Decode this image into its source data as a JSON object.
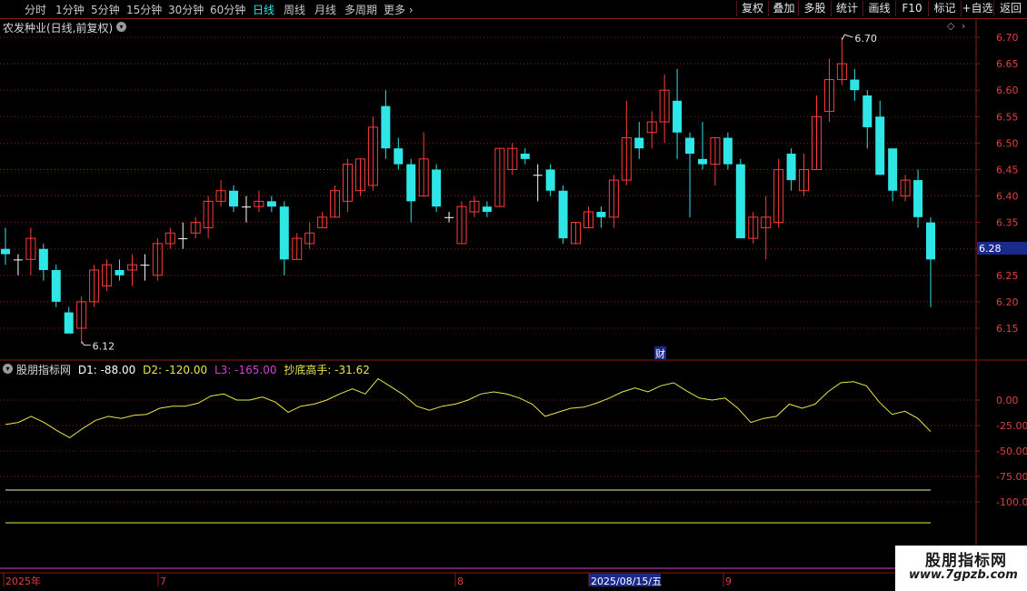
{
  "toolbar": {
    "timeframes": [
      "分时",
      "1分钟",
      "5分钟",
      "15分钟",
      "30分钟",
      "60分钟",
      "日线",
      "周线",
      "月线",
      "多周期",
      "更多"
    ],
    "active_timeframe": "日线",
    "right_buttons": [
      "复权",
      "叠加",
      "多股",
      "统计",
      "画线",
      "F10",
      "标记",
      "+自选",
      "返回"
    ]
  },
  "chart_title": "农发种业(日线,前复权)",
  "indicator": {
    "name": "股朋指标网",
    "d1_label": "D1: -88.00",
    "d2_label": "D2: -120.00",
    "l3_label": "L3: -165.00",
    "cd_label": "抄底高手: -31.62"
  },
  "annotations": {
    "high": "6.70",
    "low": "6.12",
    "fin_marker": "财",
    "current_price": "6.28"
  },
  "date_axis": {
    "labels": [
      "2025年",
      "7",
      "8",
      "2025/08/15/五",
      "9"
    ]
  },
  "watermark": {
    "line1": "股朋指标网",
    "line2": "www.7gpzb.com"
  },
  "colors": {
    "up": "#ff3b3b",
    "down": "#2ee6e6",
    "flat": "#ffffff",
    "indicator_line": "#e8e84a",
    "d1_line": "#ffffff",
    "d2_line": "#e8e84a",
    "l3": "#cc44cc",
    "grid": "#8b1a1a"
  },
  "chart_data": [
    {
      "type": "candlestick",
      "ylim": [
        6.1,
        6.72
      ],
      "yticks": [
        "6.70",
        "6.65",
        "6.60",
        "6.55",
        "6.50",
        "6.45",
        "6.40",
        "6.35",
        "6.30",
        "6.25",
        "6.20",
        "6.15"
      ],
      "candles": [
        {
          "o": 6.3,
          "h": 6.34,
          "l": 6.27,
          "c": 6.29
        },
        {
          "o": 6.28,
          "h": 6.29,
          "l": 6.25,
          "c": 6.28
        },
        {
          "o": 6.28,
          "h": 6.34,
          "l": 6.25,
          "c": 6.32
        },
        {
          "o": 6.3,
          "h": 6.31,
          "l": 6.24,
          "c": 6.26
        },
        {
          "o": 6.26,
          "h": 6.27,
          "l": 6.19,
          "c": 6.2
        },
        {
          "o": 6.18,
          "h": 6.19,
          "l": 6.14,
          "c": 6.14
        },
        {
          "o": 6.15,
          "h": 6.21,
          "l": 6.12,
          "c": 6.2
        },
        {
          "o": 6.2,
          "h": 6.27,
          "l": 6.19,
          "c": 6.26
        },
        {
          "o": 6.23,
          "h": 6.28,
          "l": 6.22,
          "c": 6.27
        },
        {
          "o": 6.26,
          "h": 6.28,
          "l": 6.24,
          "c": 6.25
        },
        {
          "o": 6.26,
          "h": 6.29,
          "l": 6.23,
          "c": 6.27
        },
        {
          "o": 6.27,
          "h": 6.29,
          "l": 6.24,
          "c": 6.27
        },
        {
          "o": 6.25,
          "h": 6.32,
          "l": 6.24,
          "c": 6.31
        },
        {
          "o": 6.31,
          "h": 6.34,
          "l": 6.3,
          "c": 6.33
        },
        {
          "o": 6.32,
          "h": 6.35,
          "l": 6.3,
          "c": 6.32
        },
        {
          "o": 6.33,
          "h": 6.36,
          "l": 6.32,
          "c": 6.35
        },
        {
          "o": 6.34,
          "h": 6.4,
          "l": 6.32,
          "c": 6.39
        },
        {
          "o": 6.39,
          "h": 6.43,
          "l": 6.38,
          "c": 6.41
        },
        {
          "o": 6.41,
          "h": 6.42,
          "l": 6.37,
          "c": 6.38
        },
        {
          "o": 6.38,
          "h": 6.4,
          "l": 6.35,
          "c": 6.38
        },
        {
          "o": 6.38,
          "h": 6.41,
          "l": 6.37,
          "c": 6.39
        },
        {
          "o": 6.39,
          "h": 6.4,
          "l": 6.37,
          "c": 6.38
        },
        {
          "o": 6.38,
          "h": 6.39,
          "l": 6.25,
          "c": 6.28
        },
        {
          "o": 6.28,
          "h": 6.33,
          "l": 6.28,
          "c": 6.32
        },
        {
          "o": 6.31,
          "h": 6.35,
          "l": 6.3,
          "c": 6.33
        },
        {
          "o": 6.34,
          "h": 6.37,
          "l": 6.34,
          "c": 6.36
        },
        {
          "o": 6.36,
          "h": 6.42,
          "l": 6.36,
          "c": 6.41
        },
        {
          "o": 6.39,
          "h": 6.47,
          "l": 6.37,
          "c": 6.46
        },
        {
          "o": 6.41,
          "h": 6.47,
          "l": 6.4,
          "c": 6.47
        },
        {
          "o": 6.42,
          "h": 6.55,
          "l": 6.41,
          "c": 6.53
        },
        {
          "o": 6.57,
          "h": 6.6,
          "l": 6.47,
          "c": 6.49
        },
        {
          "o": 6.49,
          "h": 6.51,
          "l": 6.45,
          "c": 6.46
        },
        {
          "o": 6.46,
          "h": 6.47,
          "l": 6.35,
          "c": 6.39
        },
        {
          "o": 6.4,
          "h": 6.52,
          "l": 6.4,
          "c": 6.47
        },
        {
          "o": 6.45,
          "h": 6.46,
          "l": 6.37,
          "c": 6.38
        },
        {
          "o": 6.36,
          "h": 6.37,
          "l": 6.35,
          "c": 6.36
        },
        {
          "o": 6.31,
          "h": 6.39,
          "l": 6.31,
          "c": 6.38
        },
        {
          "o": 6.37,
          "h": 6.4,
          "l": 6.36,
          "c": 6.39
        },
        {
          "o": 6.38,
          "h": 6.39,
          "l": 6.36,
          "c": 6.37
        },
        {
          "o": 6.38,
          "h": 6.49,
          "l": 6.38,
          "c": 6.49
        },
        {
          "o": 6.45,
          "h": 6.5,
          "l": 6.44,
          "c": 6.49
        },
        {
          "o": 6.48,
          "h": 6.49,
          "l": 6.46,
          "c": 6.47
        },
        {
          "o": 6.44,
          "h": 6.46,
          "l": 6.39,
          "c": 6.44
        },
        {
          "o": 6.45,
          "h": 6.46,
          "l": 6.4,
          "c": 6.41
        },
        {
          "o": 6.41,
          "h": 6.42,
          "l": 6.31,
          "c": 6.32
        },
        {
          "o": 6.31,
          "h": 6.35,
          "l": 6.31,
          "c": 6.35
        },
        {
          "o": 6.34,
          "h": 6.38,
          "l": 6.34,
          "c": 6.37
        },
        {
          "o": 6.37,
          "h": 6.38,
          "l": 6.34,
          "c": 6.36
        },
        {
          "o": 6.36,
          "h": 6.44,
          "l": 6.34,
          "c": 6.43
        },
        {
          "o": 6.43,
          "h": 6.58,
          "l": 6.42,
          "c": 6.51
        },
        {
          "o": 6.51,
          "h": 6.54,
          "l": 6.47,
          "c": 6.49
        },
        {
          "o": 6.52,
          "h": 6.56,
          "l": 6.49,
          "c": 6.54
        },
        {
          "o": 6.54,
          "h": 6.63,
          "l": 6.5,
          "c": 6.6
        },
        {
          "o": 6.58,
          "h": 6.64,
          "l": 6.47,
          "c": 6.52
        },
        {
          "o": 6.51,
          "h": 6.52,
          "l": 6.36,
          "c": 6.48
        },
        {
          "o": 6.47,
          "h": 6.54,
          "l": 6.45,
          "c": 6.46
        },
        {
          "o": 6.46,
          "h": 6.51,
          "l": 6.42,
          "c": 6.51
        },
        {
          "o": 6.51,
          "h": 6.52,
          "l": 6.45,
          "c": 6.46
        },
        {
          "o": 6.46,
          "h": 6.47,
          "l": 6.32,
          "c": 6.32
        },
        {
          "o": 6.32,
          "h": 6.37,
          "l": 6.31,
          "c": 6.36
        },
        {
          "o": 6.34,
          "h": 6.4,
          "l": 6.28,
          "c": 6.36
        },
        {
          "o": 6.35,
          "h": 6.47,
          "l": 6.34,
          "c": 6.45
        },
        {
          "o": 6.48,
          "h": 6.49,
          "l": 6.41,
          "c": 6.43
        },
        {
          "o": 6.41,
          "h": 6.48,
          "l": 6.4,
          "c": 6.45
        },
        {
          "o": 6.45,
          "h": 6.59,
          "l": 6.45,
          "c": 6.55
        },
        {
          "o": 6.56,
          "h": 6.66,
          "l": 6.54,
          "c": 6.62
        },
        {
          "o": 6.62,
          "h": 6.7,
          "l": 6.61,
          "c": 6.65
        },
        {
          "o": 6.62,
          "h": 6.64,
          "l": 6.58,
          "c": 6.6
        },
        {
          "o": 6.59,
          "h": 6.6,
          "l": 6.49,
          "c": 6.53
        },
        {
          "o": 6.55,
          "h": 6.58,
          "l": 6.44,
          "c": 6.44
        },
        {
          "o": 6.49,
          "h": 6.47,
          "l": 6.39,
          "c": 6.41
        },
        {
          "o": 6.4,
          "h": 6.44,
          "l": 6.39,
          "c": 6.43
        },
        {
          "o": 6.43,
          "h": 6.45,
          "l": 6.34,
          "c": 6.36
        },
        {
          "o": 6.35,
          "h": 6.36,
          "l": 6.19,
          "c": 6.28
        }
      ]
    },
    {
      "type": "line",
      "ylim": [
        -120,
        25
      ],
      "yticks": [
        "0.00",
        "-25.00",
        "-50.00",
        "-75.00",
        "-100.00"
      ],
      "series": [
        {
          "name": "抄底高手",
          "values": [
            -24,
            -22,
            -16,
            -22,
            -30,
            -37,
            -28,
            -20,
            -16,
            -18,
            -15,
            -14,
            -8,
            -6,
            -6,
            -3,
            4,
            6,
            0,
            0,
            3,
            -2,
            -12,
            -6,
            -4,
            0,
            6,
            11,
            6,
            21,
            13,
            5,
            -6,
            -10,
            -6,
            -4,
            0,
            6,
            8,
            6,
            2,
            -4,
            -16,
            -12,
            -8,
            -7,
            -3,
            2,
            8,
            12,
            8,
            14,
            17,
            9,
            2,
            0,
            2,
            -8,
            -22,
            -18,
            -16,
            -4,
            -8,
            -4,
            8,
            17,
            18,
            14,
            -2,
            -14,
            -11,
            -18,
            -31
          ]
        },
        {
          "name": "D1",
          "values": [
            -88
          ]
        },
        {
          "name": "D2",
          "values": [
            -120
          ]
        }
      ]
    }
  ]
}
